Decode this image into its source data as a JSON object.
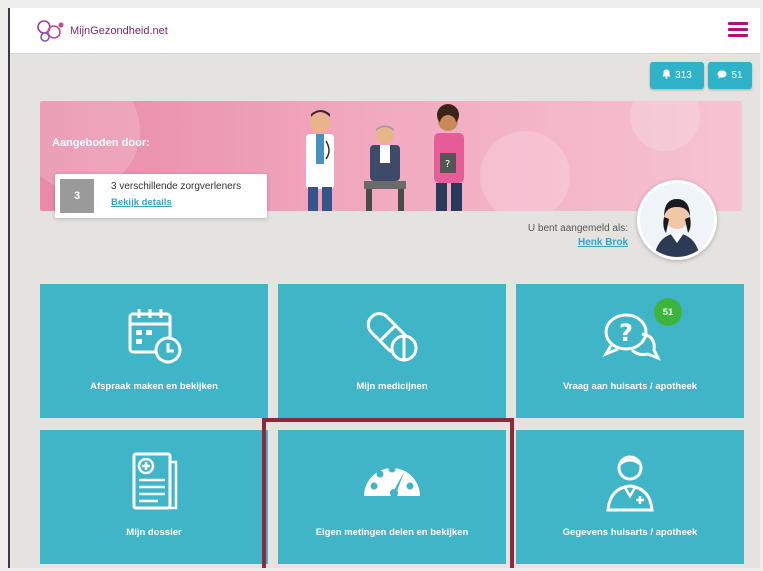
{
  "header": {
    "brand": "MijnGezondheid.net",
    "menu_icon": "hamburger-menu-icon"
  },
  "badges": {
    "notifications": {
      "icon": "bell-icon",
      "count": "313"
    },
    "messages": {
      "icon": "chat-bubble-icon",
      "count": "51"
    }
  },
  "banner": {
    "title": "Aangeboden door:",
    "provider_count": "3",
    "provider_text": "3 verschillende zorgverleners",
    "details_link": "Bekijk details"
  },
  "user": {
    "logged_in_label": "U bent aangemeld als:",
    "name": "Henk Brok"
  },
  "tiles": [
    {
      "label": "Afspraak maken en bekijken",
      "icon": "calendar-clock-icon"
    },
    {
      "label": "Mijn medicijnen",
      "icon": "pills-icon"
    },
    {
      "label": "Vraag aan huisarts / apotheek",
      "icon": "question-chat-icon",
      "count": "51"
    },
    {
      "label": "Mijn dossier",
      "icon": "medical-file-icon"
    },
    {
      "label": "Eigen metingen delen en bekijken",
      "icon": "gauge-icon"
    },
    {
      "label": "Gegevens huisarts / apotheek",
      "icon": "doctor-icon"
    }
  ],
  "colors": {
    "tile": "#40b5c7",
    "accent_magenta": "#b0107a",
    "count_badge": "#3cb53c",
    "highlight_box": "#8a2a3a"
  }
}
